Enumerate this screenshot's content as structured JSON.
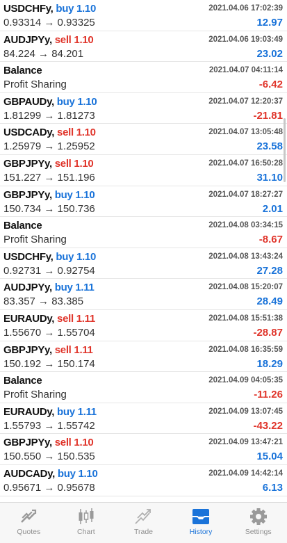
{
  "deals": [
    {
      "symbol": "USDCHFy,",
      "side": "buy 1.10",
      "side_type": "buy",
      "prices": "0.93314 → 0.93325",
      "time": "2021.04.06 17:02:39",
      "profit": "12.97",
      "profit_sign": "pos"
    },
    {
      "symbol": "AUDJPYy,",
      "side": "sell 1.10",
      "side_type": "sell",
      "prices": "84.224 → 84.201",
      "time": "2021.04.06 19:03:49",
      "profit": "23.02",
      "profit_sign": "pos"
    },
    {
      "symbol": "Balance",
      "side": "",
      "side_type": "none",
      "prices": "Profit Sharing",
      "time": "2021.04.07 04:11:14",
      "profit": "-6.42",
      "profit_sign": "neg"
    },
    {
      "symbol": "GBPAUDy,",
      "side": "buy 1.10",
      "side_type": "buy",
      "prices": "1.81299 → 1.81273",
      "time": "2021.04.07 12:20:37",
      "profit": "-21.81",
      "profit_sign": "neg"
    },
    {
      "symbol": "USDCADy,",
      "side": "sell 1.10",
      "side_type": "sell",
      "prices": "1.25979 → 1.25952",
      "time": "2021.04.07 13:05:48",
      "profit": "23.58",
      "profit_sign": "pos"
    },
    {
      "symbol": "GBPJPYy,",
      "side": "sell 1.10",
      "side_type": "sell",
      "prices": "151.227 → 151.196",
      "time": "2021.04.07 16:50:28",
      "profit": "31.10",
      "profit_sign": "pos"
    },
    {
      "symbol": "GBPJPYy,",
      "side": "buy 1.10",
      "side_type": "buy",
      "prices": "150.734 → 150.736",
      "time": "2021.04.07 18:27:27",
      "profit": "2.01",
      "profit_sign": "pos"
    },
    {
      "symbol": "Balance",
      "side": "",
      "side_type": "none",
      "prices": "Profit Sharing",
      "time": "2021.04.08 03:34:15",
      "profit": "-8.67",
      "profit_sign": "neg"
    },
    {
      "symbol": "USDCHFy,",
      "side": "buy 1.10",
      "side_type": "buy",
      "prices": "0.92731 → 0.92754",
      "time": "2021.04.08 13:43:24",
      "profit": "27.28",
      "profit_sign": "pos"
    },
    {
      "symbol": "AUDJPYy,",
      "side": "buy 1.11",
      "side_type": "buy",
      "prices": "83.357 → 83.385",
      "time": "2021.04.08 15:20:07",
      "profit": "28.49",
      "profit_sign": "pos"
    },
    {
      "symbol": "EURAUDy,",
      "side": "sell 1.11",
      "side_type": "sell",
      "prices": "1.55670 → 1.55704",
      "time": "2021.04.08 15:51:38",
      "profit": "-28.87",
      "profit_sign": "neg"
    },
    {
      "symbol": "GBPJPYy,",
      "side": "sell 1.11",
      "side_type": "sell",
      "prices": "150.192 → 150.174",
      "time": "2021.04.08 16:35:59",
      "profit": "18.29",
      "profit_sign": "pos"
    },
    {
      "symbol": "Balance",
      "side": "",
      "side_type": "none",
      "prices": "Profit Sharing",
      "time": "2021.04.09 04:05:35",
      "profit": "-11.26",
      "profit_sign": "neg"
    },
    {
      "symbol": "EURAUDy,",
      "side": "buy 1.11",
      "side_type": "buy",
      "prices": "1.55793 → 1.55742",
      "time": "2021.04.09 13:07:45",
      "profit": "-43.22",
      "profit_sign": "neg"
    },
    {
      "symbol": "GBPJPYy,",
      "side": "sell 1.10",
      "side_type": "sell",
      "prices": "150.550 → 150.535",
      "time": "2021.04.09 13:47:21",
      "profit": "15.04",
      "profit_sign": "pos"
    },
    {
      "symbol": "AUDCADy,",
      "side": "buy 1.10",
      "side_type": "buy",
      "prices": "0.95671 → 0.95678",
      "time": "2021.04.09 14:42:14",
      "profit": "6.13",
      "profit_sign": "pos"
    }
  ],
  "tabs": [
    {
      "label": "Quotes",
      "icon": "quotes-icon"
    },
    {
      "label": "Chart",
      "icon": "chart-icon"
    },
    {
      "label": "Trade",
      "icon": "trade-icon"
    },
    {
      "label": "History",
      "icon": "history-icon",
      "active": true
    },
    {
      "label": "Settings",
      "icon": "settings-icon"
    }
  ],
  "colors": {
    "buy": "#1a73d9",
    "sell": "#e0352b",
    "active_tab": "#1a73d9",
    "inactive_tab": "#8e8e8e"
  }
}
